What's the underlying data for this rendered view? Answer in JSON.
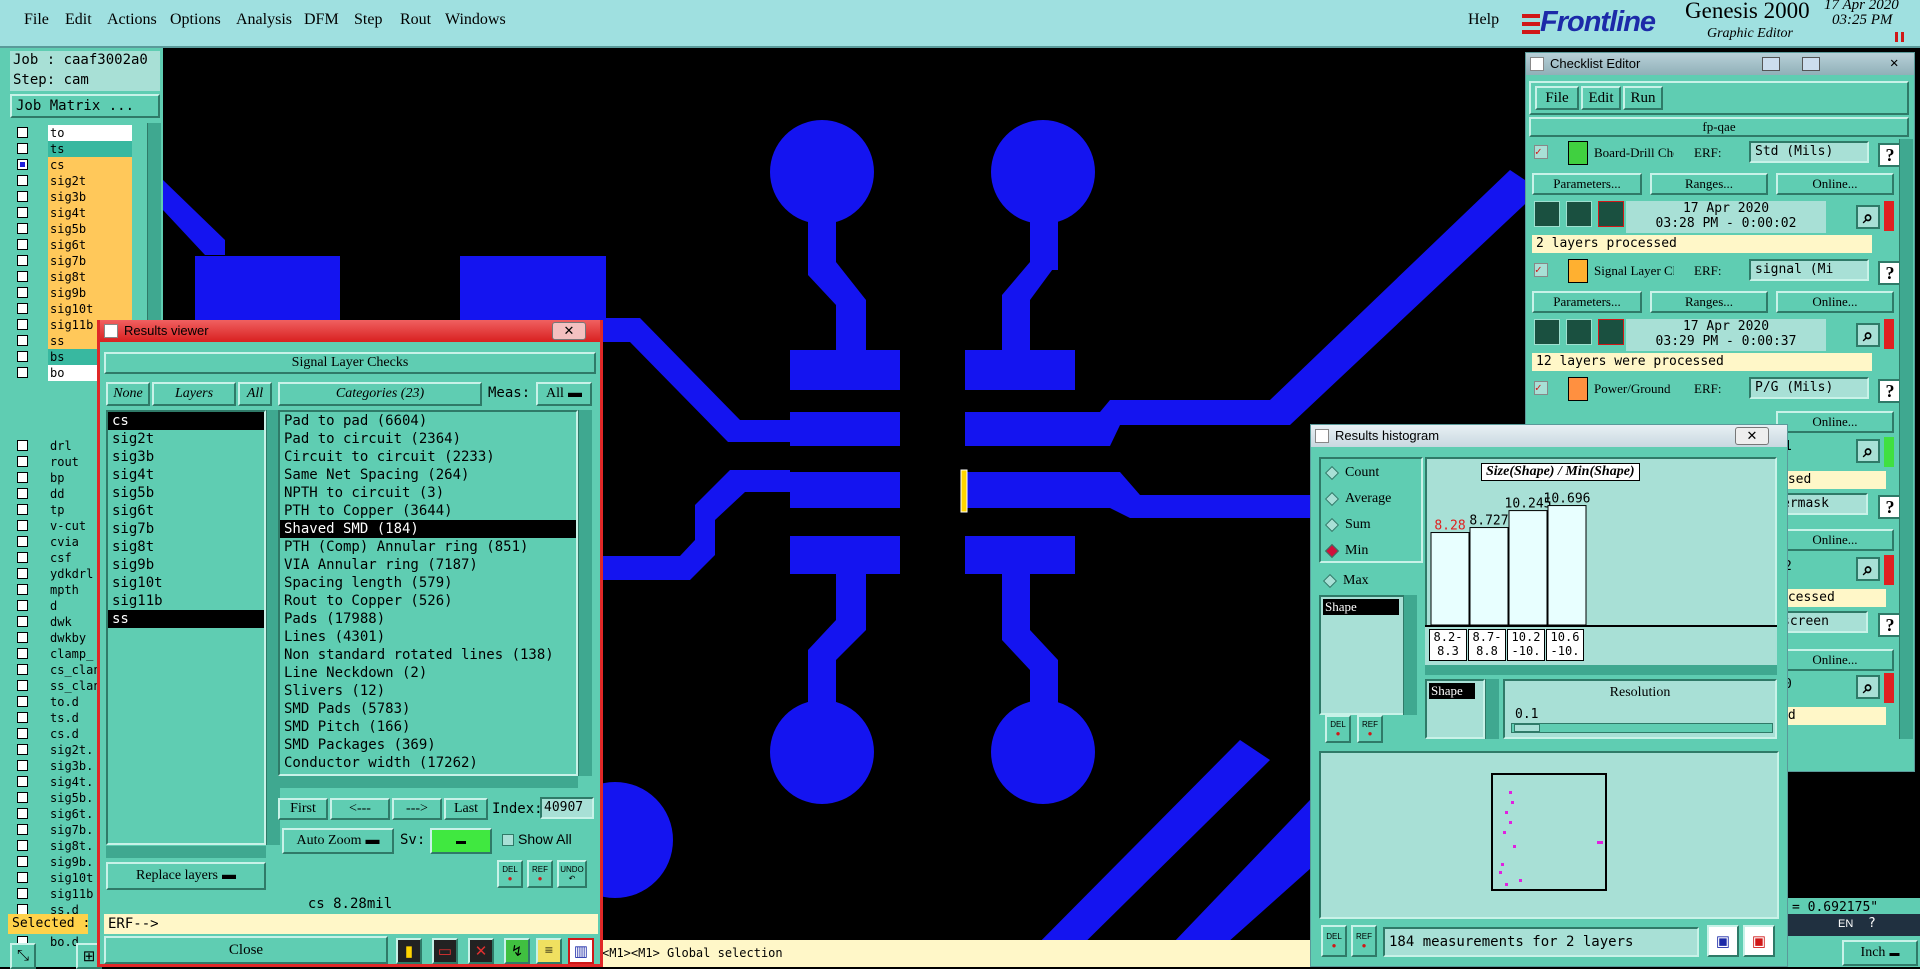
{
  "menubar": {
    "items": [
      "File",
      "Edit",
      "Actions",
      "Options",
      "Analysis",
      "DFM",
      "Step",
      "Rout",
      "Windows"
    ],
    "help": "Help",
    "brand": "Frontline",
    "product": "Genesis 2000",
    "subtitle": "Graphic Editor",
    "date": "17 Apr 2020",
    "time": "03:25 PM",
    "accent": "#d01818"
  },
  "left": {
    "job": "Job : caaf3002a0",
    "step": "Step: cam",
    "job_matrix": "Job Matrix ...",
    "layers_top": [
      {
        "name": "to",
        "color": "#ffffff"
      },
      {
        "name": "ts",
        "color": "#38b8a0"
      },
      {
        "name": "cs",
        "color": "#ffc85a",
        "checked": true
      },
      {
        "name": "sig2t",
        "color": "#ffc85a"
      },
      {
        "name": "sig3b",
        "color": "#ffc85a"
      },
      {
        "name": "sig4t",
        "color": "#ffc85a"
      },
      {
        "name": "sig5b",
        "color": "#ffc85a"
      },
      {
        "name": "sig6t",
        "color": "#ffc85a"
      },
      {
        "name": "sig7b",
        "color": "#ffc85a"
      },
      {
        "name": "sig8t",
        "color": "#ffc85a"
      },
      {
        "name": "sig9b",
        "color": "#ffc85a"
      },
      {
        "name": "sig10t",
        "color": "#ffc85a"
      },
      {
        "name": "sig11b",
        "color": "#ffc85a"
      },
      {
        "name": "ss",
        "color": "#ffc85a"
      },
      {
        "name": "bs",
        "color": "#38b8a0"
      },
      {
        "name": "bo",
        "color": "#ffffff"
      }
    ],
    "layers_bottom": [
      "drl",
      "rout",
      "bp",
      "dd",
      "tp",
      "v-cut",
      "cvia",
      "csf",
      "ydkdrl",
      "mpth",
      "d",
      "dwk",
      "dwkby",
      "clamp_",
      "cs_clan",
      "ss_clan",
      "to.d",
      "ts.d",
      "cs.d",
      "sig2t.",
      "sig3b.",
      "sig4t.",
      "sig5b.",
      "sig6t.",
      "sig7b.",
      "sig8t.",
      "sig9b.",
      "sig10t",
      "sig11b",
      "ss.d",
      "bs.d",
      "bo.d"
    ],
    "selected": "Selected :"
  },
  "results_viewer": {
    "title": "Results viewer",
    "header": "Signal Layer Checks",
    "none": "None",
    "layers": "Layers",
    "all": "All",
    "categories": "Categories (23)",
    "meas_label": "Meas:",
    "meas_value": "All",
    "layer_list": [
      "cs",
      "sig2t",
      "sig3b",
      "sig4t",
      "sig5b",
      "sig6t",
      "sig7b",
      "sig8t",
      "sig9b",
      "sig10t",
      "sig11b",
      "ss"
    ],
    "category_list": [
      "Pad to pad (6604)",
      "Pad to circuit (2364)",
      "Circuit to circuit (2233)",
      "Same Net Spacing (264)",
      "NPTH to circuit (3)",
      "PTH to Copper (3644)",
      "Shaved SMD (184)",
      "PTH (Comp) Annular ring (851)",
      "VIA Annular ring (7187)",
      "Spacing length (579)",
      "Rout to Copper (526)",
      "Pads (17988)",
      "Lines (4301)",
      "Non standard rotated lines (138)",
      "Line Neckdown (2)",
      "Slivers (12)",
      "SMD Pads (5783)",
      "SMD Pitch (166)",
      "SMD Packages (369)",
      "Conductor width (17262)"
    ],
    "nav": [
      "First",
      "<---",
      "--->",
      "Last"
    ],
    "index_label": "Index:",
    "index_value": "40907",
    "auto_zoom": "Auto Zoom",
    "sv": "Sv:",
    "show_all": "Show All",
    "replace_layers": "Replace layers",
    "del": "DEL",
    "ref": "REF",
    "undo": "UNDO",
    "measure": "cs 8.28mil",
    "erf": "ERF-->",
    "close": "Close",
    "title_bar_color": "#e02828"
  },
  "status_line": "<M1><M1> Global selection",
  "checklist": {
    "title": "Checklist Editor",
    "menu": [
      "File",
      "Edit",
      "Run"
    ],
    "name": "fp-qae",
    "erf_label": "ERF:",
    "params": "Parameters...",
    "ranges": "Ranges...",
    "online": "Online...",
    "checks": [
      {
        "name": "Board-Drill Che",
        "erf": "Std (Mils)",
        "date": "17 Apr 2020",
        "time": "03:28 PM - 0:00:02",
        "status": "2 layers processed"
      },
      {
        "name": "Signal Layer Ch",
        "erf": "signal (Mi",
        "date": "17 Apr 2020",
        "time": "03:29 PM - 0:00:37",
        "status": "12 layers were processed"
      },
      {
        "name": "Power/Ground C",
        "erf": "P/G (Mils)"
      }
    ],
    "frag_status1": "ssed",
    "frag_item": "ermask",
    "frag_status2": "ocessed",
    "frag_item2": "screen",
    "frag_status3": "ed",
    "frag_num": "2",
    "frag_num2": "1",
    "frag_num3": "0"
  },
  "histogram": {
    "title": "Results histogram",
    "options": [
      "Count",
      "Average",
      "Sum",
      "Min",
      "Max"
    ],
    "selected_option": "Min",
    "chart_title": "Size(Shape) / Min(Shape)",
    "shape_label": "Shape",
    "resolution_label": "Resolution",
    "resolution_value": "0.1",
    "summary": "184 measurements for 2 layers",
    "del": "DEL",
    "ref": "REF",
    "highlight_color": "#e02020"
  },
  "chart_data": {
    "type": "bar",
    "categories": [
      "8.2-8.3",
      "8.7-8.8",
      "10.2-10.3",
      "10.6-10.7"
    ],
    "values": [
      8.28,
      8.727,
      10.245,
      10.696
    ],
    "value_labels": [
      "8.28",
      "8.727",
      "10.245",
      "10.696"
    ],
    "title": "Size(Shape) / Min(Shape)",
    "ylim": [
      0,
      12
    ]
  },
  "bottom_right": {
    "coord": "= 0.692175\"",
    "unit": "Inch",
    "lang": "EN"
  }
}
